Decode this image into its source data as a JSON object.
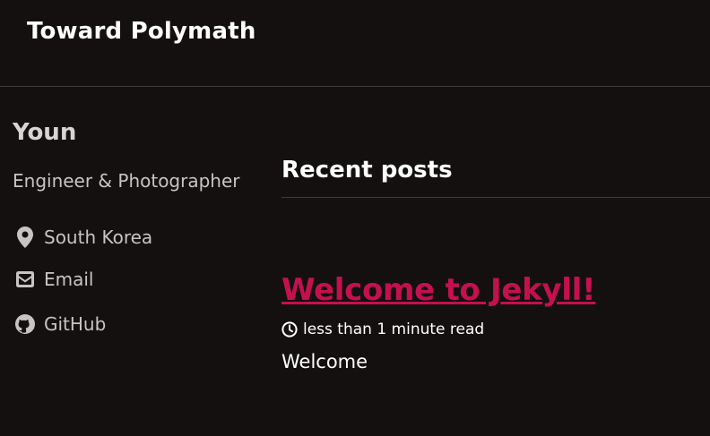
{
  "masthead": {
    "site_title": "Toward Polymath"
  },
  "sidebar": {
    "author_name": "Youn",
    "author_bio": "Engineer & Photographer",
    "links": [
      {
        "label": "South Korea",
        "icon": "map-marker-icon"
      },
      {
        "label": "Email",
        "icon": "envelope-icon"
      },
      {
        "label": "GitHub",
        "icon": "github-icon"
      }
    ]
  },
  "main": {
    "section_title": "Recent posts",
    "posts": [
      {
        "title": "Welcome to Jekyll!",
        "read_time": "less than 1 minute read",
        "excerpt": "Welcome"
      }
    ]
  },
  "colors": {
    "background": "#141010",
    "link": "#c4104f",
    "text": "#ffffff",
    "muted_text": "#c9c4c4",
    "divider": "#3e3a3a"
  }
}
